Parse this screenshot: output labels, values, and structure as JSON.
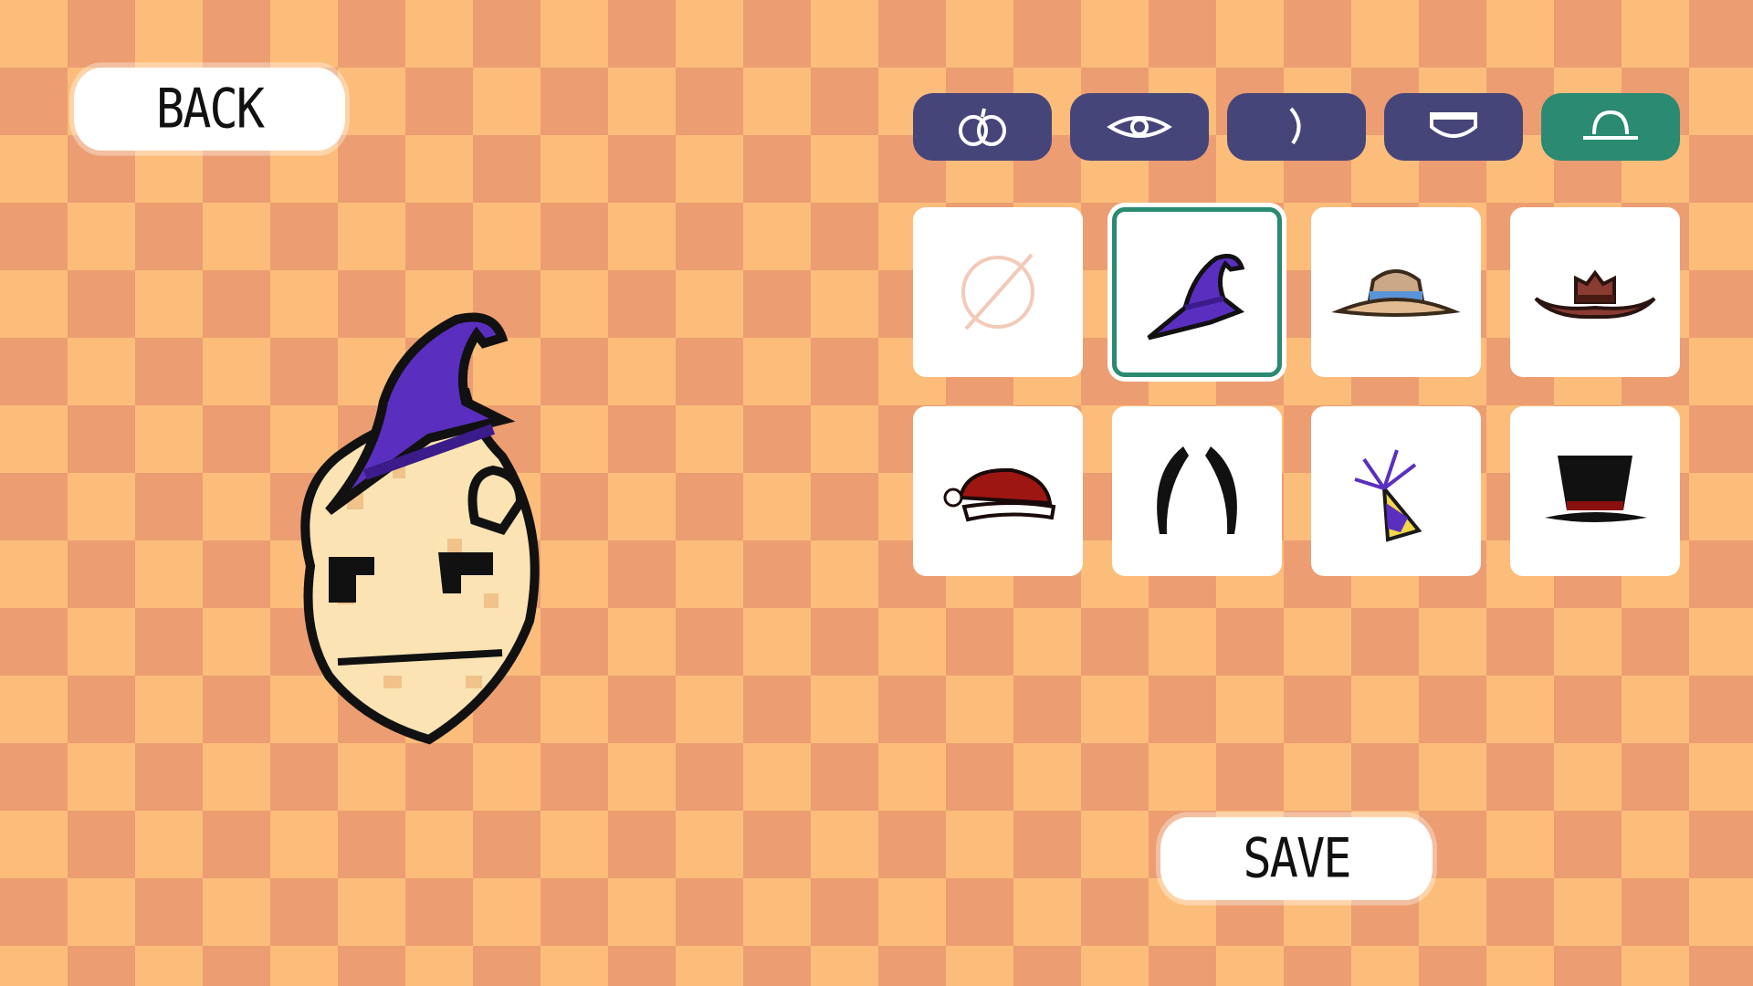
{
  "buttons": {
    "back_label": "BACK",
    "save_label": "SAVE"
  },
  "tabs": [
    {
      "icon": "pumpkin-body-icon",
      "active": false
    },
    {
      "icon": "eye-icon",
      "active": false
    },
    {
      "icon": "nose-icon",
      "active": false
    },
    {
      "icon": "mouth-icon",
      "active": false
    },
    {
      "icon": "hat-icon",
      "active": true
    }
  ],
  "hat_options": [
    {
      "icon": "none-icon",
      "selected": false
    },
    {
      "icon": "witch-hat-icon",
      "selected": true
    },
    {
      "icon": "sun-hat-icon",
      "selected": false
    },
    {
      "icon": "cowboy-hat-icon",
      "selected": false
    },
    {
      "icon": "santa-hat-icon",
      "selected": false
    },
    {
      "icon": "horns-icon",
      "selected": false
    },
    {
      "icon": "party-hat-icon",
      "selected": false
    },
    {
      "icon": "top-hat-icon",
      "selected": false
    }
  ],
  "colors": {
    "checker_light": "#fcbd7b",
    "checker_dark": "#ec9d71",
    "tab_inactive": "#46457a",
    "tab_active": "#2a8a72",
    "hat_purple": "#5a2fc0",
    "pumpkin_cream": "#fbe3b4"
  }
}
